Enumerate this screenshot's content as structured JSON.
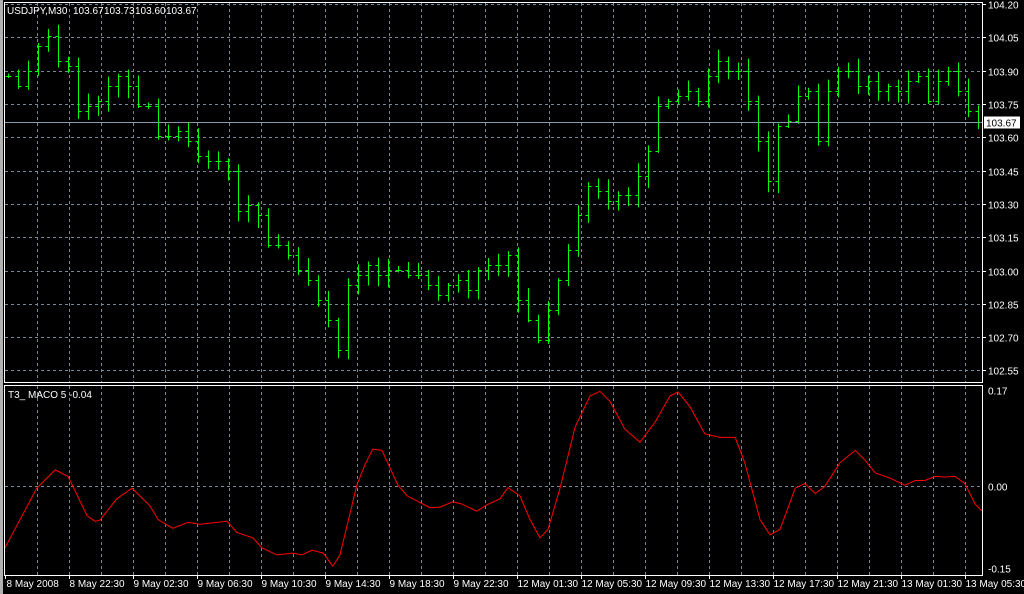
{
  "header": {
    "symbol": "USDJPY,M30",
    "open": "103.67",
    "high": "103.73",
    "low": "103.60",
    "close": "103.67"
  },
  "indicator": {
    "label": "T3_ MACO 5 -0.04"
  },
  "colors": {
    "background": "#000000",
    "bars": "#00ff00",
    "indicator_line": "#ff0000",
    "grid": "#778899",
    "frame": "#ffffff"
  },
  "chart_data": [
    {
      "type": "ohlc-bar",
      "title": "USDJPY,M30",
      "ylim": [
        102.498,
        104.205
      ],
      "price_ticks": [
        "104.20",
        "104.05",
        "103.90",
        "103.75",
        "103.60",
        "103.45",
        "103.30",
        "103.15",
        "103.00",
        "102.85",
        "102.70",
        "102.55"
      ],
      "last_price": "103.67",
      "x_start": 0,
      "x_step": 1.25,
      "closes": [
        103.877,
        103.832,
        103.899,
        104.011,
        104.056,
        103.944,
        103.922,
        103.72,
        103.742,
        103.764,
        103.832,
        103.877,
        103.832,
        103.742,
        103.742,
        103.607,
        103.607,
        103.63,
        103.585,
        103.517,
        103.495,
        103.495,
        103.45,
        103.27,
        103.293,
        103.248,
        103.113,
        103.113,
        103.068,
        103.001,
        102.956,
        102.866,
        102.777,
        102.642,
        102.936,
        102.981,
        103.026,
        102.981,
        103.001,
        103.001,
        102.979,
        102.979,
        102.934,
        102.889,
        102.934,
        102.956,
        102.911,
        103.001,
        103.024,
        103.024,
        103.068,
        102.866,
        102.777,
        102.687,
        102.821,
        102.956,
        103.091,
        103.248,
        103.383,
        103.36,
        103.315,
        103.338,
        103.338,
        103.428,
        103.54,
        103.742,
        103.764,
        103.787,
        103.809,
        103.764,
        103.877,
        103.944,
        103.899,
        103.899,
        103.764,
        103.585,
        103.405,
        103.652,
        103.675,
        103.787,
        103.809,
        103.585,
        103.809,
        103.899,
        103.899,
        103.832,
        103.854,
        103.809,
        103.832,
        103.809,
        103.854,
        103.877,
        103.764,
        103.854,
        103.899,
        103.809,
        103.72,
        103.67
      ]
    },
    {
      "type": "line",
      "title": "T3_ MACO 5",
      "ylim": [
        -0.15,
        0.17
      ],
      "y_ticks": [
        "0.17",
        "0.00",
        "-0.15"
      ],
      "x_unit": "bar index (30 min)",
      "points": [
        [
          -0.4,
          -0.104
        ],
        [
          3.6,
          -0.003
        ],
        [
          5.9,
          0.028
        ],
        [
          7.5,
          0.017
        ],
        [
          9.9,
          -0.05
        ],
        [
          10.9,
          -0.059
        ],
        [
          11.5,
          -0.057
        ],
        [
          13.6,
          -0.021
        ],
        [
          15.5,
          -0.003
        ],
        [
          17.75,
          -0.033
        ],
        [
          18.75,
          -0.056
        ],
        [
          20.6,
          -0.071
        ],
        [
          22.5,
          -0.061
        ],
        [
          24,
          -0.064
        ],
        [
          27.4,
          -0.059
        ],
        [
          28.6,
          -0.078
        ],
        [
          30.6,
          -0.087
        ],
        [
          31.75,
          -0.104
        ],
        [
          33.6,
          -0.116
        ],
        [
          35.6,
          -0.113
        ],
        [
          36.75,
          -0.116
        ],
        [
          38,
          -0.108
        ],
        [
          39.4,
          -0.113
        ],
        [
          40.6,
          -0.135
        ],
        [
          41.5,
          -0.116
        ],
        [
          43.6,
          0.002
        ],
        [
          44.6,
          0.036
        ],
        [
          45.6,
          0.063
        ],
        [
          46.75,
          0.061
        ],
        [
          48.75,
          0.002
        ],
        [
          49.9,
          -0.016
        ],
        [
          52.75,
          -0.036
        ],
        [
          54,
          -0.035
        ],
        [
          55.6,
          -0.026
        ],
        [
          56.75,
          -0.03
        ],
        [
          58.6,
          -0.042
        ],
        [
          59.9,
          -0.031
        ],
        [
          61.5,
          -0.021
        ],
        [
          62.5,
          -0.002
        ],
        [
          64,
          -0.016
        ],
        [
          65.25,
          -0.056
        ],
        [
          66.5,
          -0.087
        ],
        [
          67.5,
          -0.073
        ],
        [
          69,
          -0.003
        ],
        [
          70.9,
          0.101
        ],
        [
          72.75,
          0.153
        ],
        [
          74,
          0.161
        ],
        [
          75.25,
          0.144
        ],
        [
          77.1,
          0.097
        ],
        [
          79,
          0.075
        ],
        [
          80.9,
          0.109
        ],
        [
          82.75,
          0.153
        ],
        [
          83.75,
          0.16
        ],
        [
          85.25,
          0.135
        ],
        [
          87.1,
          0.089
        ],
        [
          89,
          0.083
        ],
        [
          90.9,
          0.083
        ],
        [
          92.1,
          0.04
        ],
        [
          94,
          -0.056
        ],
        [
          95.25,
          -0.082
        ],
        [
          96.5,
          -0.073
        ],
        [
          98.4,
          -0.003
        ],
        [
          99.6,
          0.005
        ],
        [
          100.9,
          -0.012
        ],
        [
          102.1,
          0
        ],
        [
          104,
          0.04
        ],
        [
          105.9,
          0.061
        ],
        [
          107.1,
          0.045
        ],
        [
          108.4,
          0.023
        ],
        [
          110.25,
          0.014
        ],
        [
          112.1,
          0.002
        ],
        [
          113.4,
          0.01
        ],
        [
          114.6,
          0.01
        ],
        [
          115.9,
          0.017
        ],
        [
          117.1,
          0.016
        ],
        [
          118.4,
          0.017
        ],
        [
          119.6,
          0.005
        ],
        [
          120.9,
          -0.03
        ],
        [
          121.9,
          -0.042
        ]
      ]
    }
  ],
  "time_axis": [
    "8 May 2008",
    "8 May 22:30",
    "9 May 02:30",
    "9 May 06:30",
    "9 May 10:30",
    "9 May 14:30",
    "9 May 18:30",
    "9 May 22:30",
    "12 May 01:30",
    "12 May 05:30",
    "12 May 09:30",
    "12 May 13:30",
    "12 May 17:30",
    "12 May 21:30",
    "13 May 01:30",
    "13 May 05:30"
  ]
}
